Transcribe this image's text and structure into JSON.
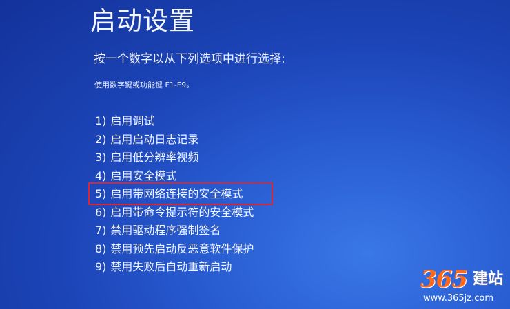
{
  "title": "启动设置",
  "subtitle": "按一个数字以从下列选项中进行选择:",
  "hint": "使用数字键或功能键 F1-F9。",
  "options": [
    {
      "num": "1)",
      "label": "启用调试"
    },
    {
      "num": "2)",
      "label": "启用启动日志记录"
    },
    {
      "num": "3)",
      "label": "启用低分辨率视频"
    },
    {
      "num": "4)",
      "label": "启用安全模式"
    },
    {
      "num": "5)",
      "label": "启用带网络连接的安全模式"
    },
    {
      "num": "6)",
      "label": "启用带命令提示符的安全模式"
    },
    {
      "num": "7)",
      "label": "禁用驱动程序强制签名"
    },
    {
      "num": "8)",
      "label": "禁用预先启动反恶意软件保护"
    },
    {
      "num": "9)",
      "label": "禁用失败后自动重新启动"
    }
  ],
  "highlighted_option": "5)",
  "colors": {
    "background": "#1c45b8",
    "highlight_border": "#e0242c",
    "watermark_orange": "#ff6a1a"
  },
  "watermark": {
    "digits": "365",
    "text": "建站",
    "url": "www.365jz.com"
  }
}
